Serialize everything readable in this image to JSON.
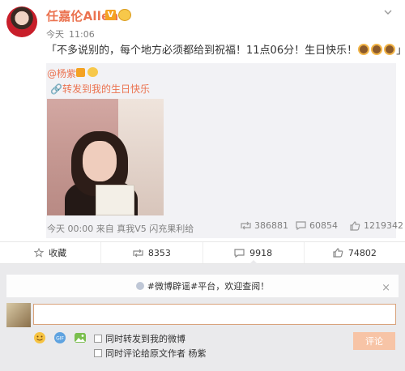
{
  "post": {
    "author": "任嘉伦Allen",
    "vip_badge": "V",
    "time_day": "今天",
    "time_clock": "11:06",
    "text": "「不多说别的，每个地方必须都给到祝福！11点06分！生日快乐！",
    "text_end": "」"
  },
  "repost": {
    "author": "@杨紫",
    "text": "转发到我的生日快乐",
    "meta": "今天 00:00 来自 真我V5 闪充果利给",
    "stats": {
      "reposts": "386881",
      "comments": "60854",
      "likes": "1219342"
    }
  },
  "actions": {
    "favorite": "收藏",
    "repost": "8353",
    "comment": "9918",
    "like": "74802"
  },
  "comments": {
    "notice": "#微博辟谣#平台，欢迎查阅！",
    "close": "×",
    "input_value": "",
    "checkbox_forward": "同时转发到我的微博",
    "checkbox_comment": "同时评论给原文作者 杨紫",
    "submit": "评论"
  },
  "icons": {
    "crown": "crown-emoji-icon",
    "cake": "cake-emoji-icon",
    "favorite": "star-icon",
    "repost": "repost-icon",
    "comment": "comment-icon",
    "like": "thumbs-up-icon",
    "emoji": "smile-icon",
    "gif": "gif-icon",
    "image": "image-icon"
  },
  "colors": {
    "accent": "#eb7350",
    "text": "#333333",
    "muted": "#808080",
    "panel": "#eaeaec"
  }
}
